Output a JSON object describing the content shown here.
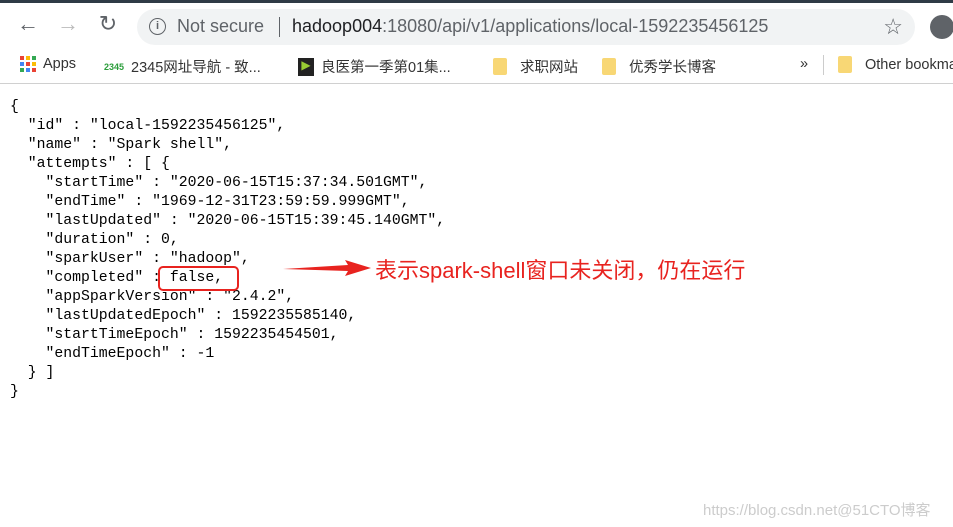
{
  "browser": {
    "back": "←",
    "forward": "→",
    "reload": "↻",
    "security_label": "Not secure",
    "url_host": "hadoop004",
    "url_rest": ":18080/api/v1/applications/local-1592235456125"
  },
  "bookmarks": [
    {
      "label": "Apps",
      "icon": "apps-grid-icon"
    },
    {
      "label": "2345网址导航 - 致...",
      "icon": "2345-icon"
    },
    {
      "label": "良医第一季第01集...",
      "icon": "video-icon"
    },
    {
      "label": "求职网站",
      "icon": "folder-icon"
    },
    {
      "label": "优秀学长博客",
      "icon": "folder-icon"
    },
    {
      "label": "»",
      "icon": "more"
    },
    {
      "label": "Other bookmarks",
      "icon": "folder-icon"
    }
  ],
  "json_lines": [
    "{",
    "  \"id\" : \"local-1592235456125\",",
    "  \"name\" : \"Spark shell\",",
    "  \"attempts\" : [ {",
    "    \"startTime\" : \"2020-06-15T15:37:34.501GMT\",",
    "    \"endTime\" : \"1969-12-31T23:59:59.999GMT\",",
    "    \"lastUpdated\" : \"2020-06-15T15:39:45.140GMT\",",
    "    \"duration\" : 0,",
    "    \"sparkUser\" : \"hadoop\",",
    "    \"completed\" : false,",
    "    \"appSparkVersion\" : \"2.4.2\",",
    "    \"lastUpdatedEpoch\" : 1592235585140,",
    "    \"startTimeEpoch\" : 1592235454501,",
    "    \"endTimeEpoch\" : -1",
    "  } ]",
    "}"
  ],
  "annotation": {
    "text": "表示spark-shell窗口未关闭，仍在运行",
    "color": "#e8231f"
  },
  "watermark": "https://blog.csdn.net@51CTO博客"
}
